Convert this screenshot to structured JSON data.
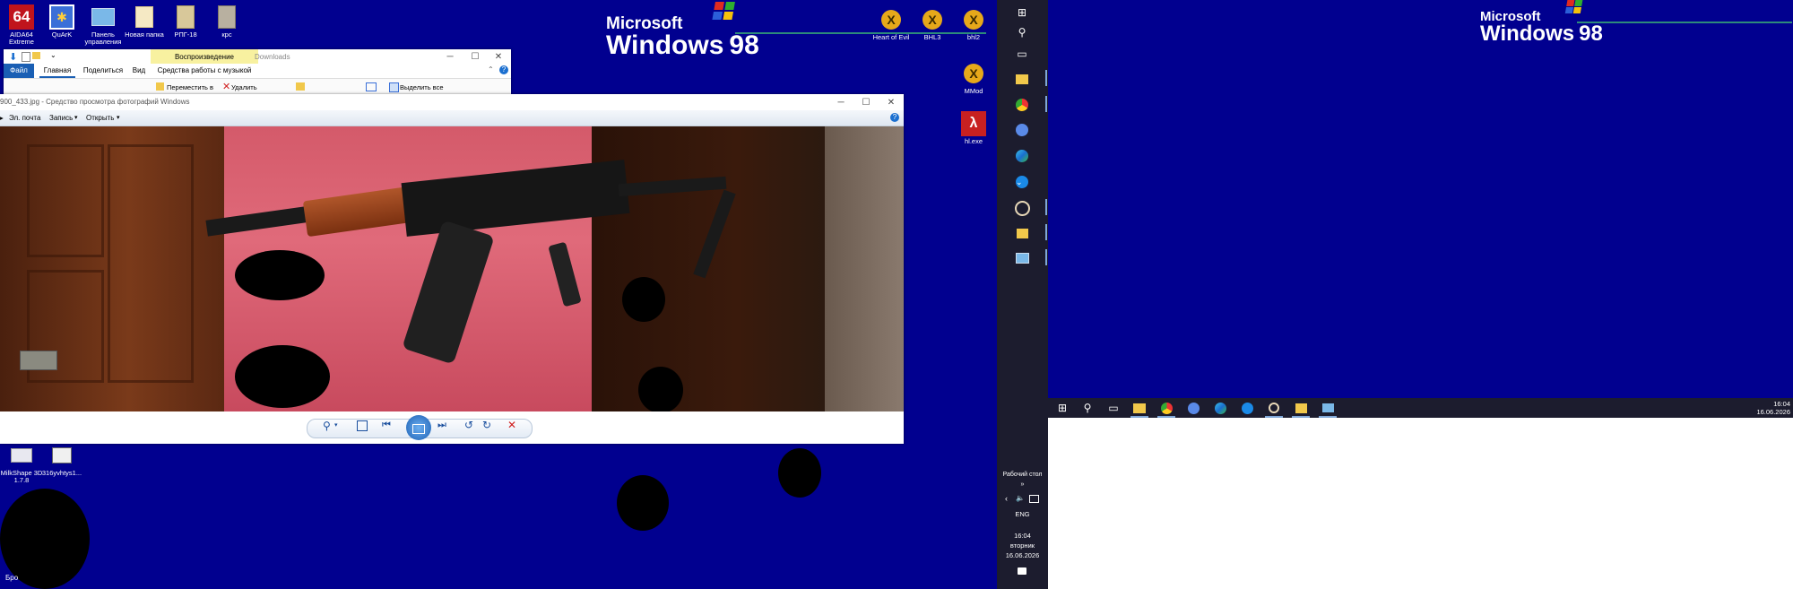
{
  "desktop_left": {
    "icons_top": [
      {
        "name": "aida64-icon",
        "label": "AIDA64 Extreme",
        "glyph": "64"
      },
      {
        "name": "quark-icon",
        "label": "QuArK",
        "glyph": ""
      },
      {
        "name": "control-panel-icon",
        "label": "Панель управления",
        "glyph": ""
      },
      {
        "name": "folder-icon",
        "label": "Новая папка",
        "glyph": ""
      },
      {
        "name": "rpg-folder-icon",
        "label": "РПГ-18",
        "glyph": ""
      },
      {
        "name": "krs-icon",
        "label": "крс",
        "glyph": ""
      }
    ],
    "icons_right": [
      {
        "name": "heart-of-evil-icon",
        "label": "Heart of Evil"
      },
      {
        "name": "bhl3-icon",
        "label": "BHL3"
      },
      {
        "name": "bhl2-icon",
        "label": "bhl2"
      },
      {
        "name": "mmod-icon",
        "label": "MMod"
      },
      {
        "name": "hl-exe-icon",
        "label": "hl.exe"
      }
    ],
    "icons_bottom": [
      {
        "name": "milkshape-icon",
        "label": "MilkShape 3D 1.7.8"
      },
      {
        "name": "file-icon",
        "label": "316yvhtys1..."
      }
    ],
    "bottom_text": "Бро",
    "logo_ms": "Microsoft",
    "logo_win": "Windows",
    "logo_ver": "98"
  },
  "explorer": {
    "tabs": [
      "Файл",
      "Главная",
      "Поделиться",
      "Вид",
      "Средства работы с музыкой"
    ],
    "contextual_header": "Воспроизведение",
    "path": "Downloads",
    "ribbon": {
      "move": "Переместить в",
      "delete": "Удалить",
      "select_all": "Выделить все"
    }
  },
  "photo_viewer": {
    "title": "900_433.jpg - Средство просмотра фотографий Windows",
    "menu": [
      "Эл. почта",
      "Запись",
      "Открыть"
    ],
    "help": "?"
  },
  "vertical_taskbar": {
    "desktop_label": "Рабочий стол",
    "lang": "ENG",
    "time": "16:04",
    "weekday": "вторник",
    "date": "16.06.2026"
  },
  "desktop_right": {
    "logo_ms": "Microsoft",
    "logo_win": "Windows",
    "logo_ver": "98",
    "clock_time": "16:04",
    "clock_date": "16.06.2026"
  },
  "colors": {
    "desktop": "#01008f",
    "taskbar": "#1c1c2e",
    "accent": "#0a64c8"
  }
}
